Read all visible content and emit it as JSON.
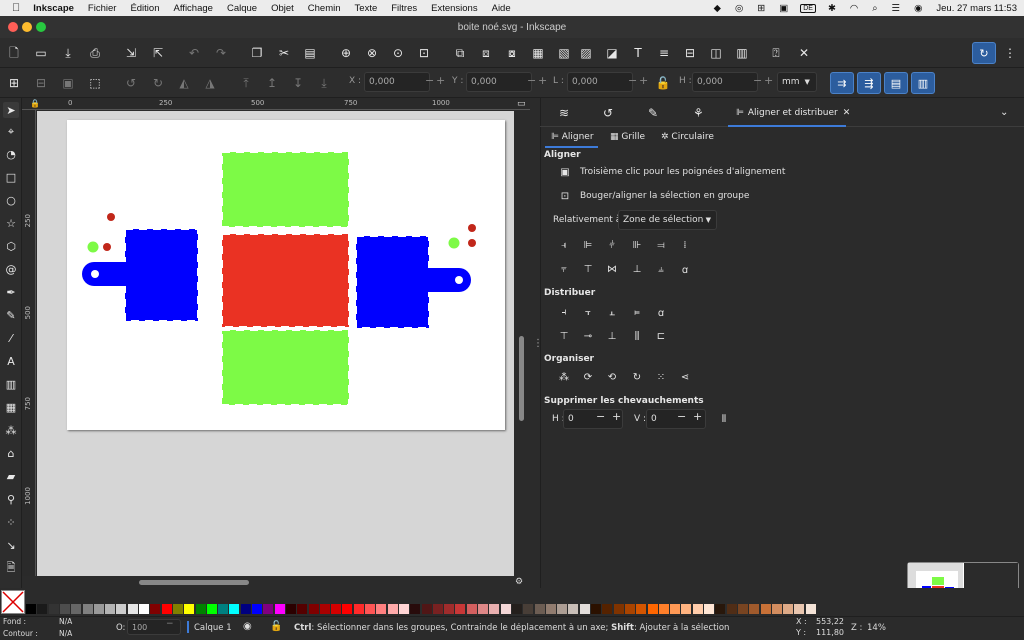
{
  "menubar": {
    "app": "Inkscape",
    "items": [
      "Fichier",
      "Édition",
      "Affichage",
      "Calque",
      "Objet",
      "Chemin",
      "Texte",
      "Filtres",
      "Extensions",
      "Aide"
    ],
    "clock": "Jeu. 27 mars  11:53",
    "badge": "DE"
  },
  "window": {
    "title": "boite noé.svg - Inkscape"
  },
  "controls": {
    "x_label": "X :",
    "x_value": "0,000",
    "y_label": "Y :",
    "y_value": "0,000",
    "l_label": "L :",
    "l_value": "0,000",
    "h_label": "H :",
    "h_value": "0,000",
    "unit": "mm"
  },
  "rulers": {
    "h": [
      "0",
      "250",
      "500",
      "750",
      "1000"
    ],
    "v": [
      "250",
      "500",
      "750",
      "1000"
    ]
  },
  "dock": {
    "active_tab": "Aligner et distribuer",
    "subtabs": [
      "Aligner",
      "Grille",
      "Circulaire"
    ],
    "aligner_heading": "Aligner",
    "opt1": "Troisième clic pour les poignées d'alignement",
    "opt2": "Bouger/aligner la sélection en groupe",
    "relative_label": "Relativement à :",
    "relative_value": "Zone de sélection",
    "distribute_heading": "Distribuer",
    "organise_heading": "Organiser",
    "overlap_heading": "Supprimer les chevauchements",
    "h_label": "H :",
    "h_value": "0",
    "v_label": "V :",
    "v_value": "0"
  },
  "status": {
    "fill_label": "Fond :",
    "fill_value": "N/A",
    "stroke_label": "Contour :",
    "stroke_value": "N/A",
    "opacity_label": "O:",
    "opacity_value": "100",
    "layer": "Calque 1",
    "hint_ctrl": "Ctrl",
    "hint1": ": Sélectionner dans les groupes, Contrainde le déplacement à un axe; ",
    "hint_shift": "Shift",
    "hint2": ": Ajouter à la sélection",
    "x_label": "X :",
    "x_value": "553,22",
    "y_label": "Y :",
    "y_value": "111,80",
    "z_label": "Z :",
    "z_value": "14%"
  },
  "colors": {
    "green": "#7dfa46",
    "red": "#ea3223",
    "blue": "#0000ff",
    "dotred": "#c1271a",
    "accent": "#3d7bd9"
  }
}
